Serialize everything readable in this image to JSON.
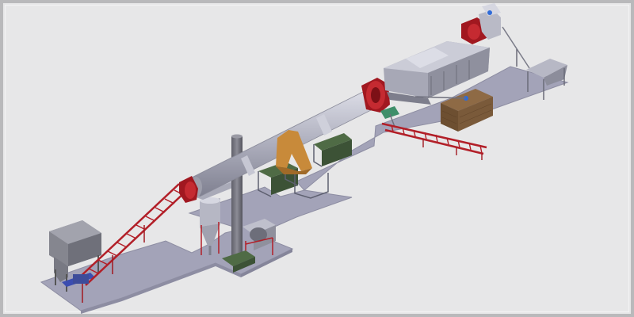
{
  "scene": {
    "background": "#e7e7e8",
    "frame_color": "#b9b9bb",
    "colors": {
      "floor": "#a3a3b8",
      "floor_edge": "#8d8da2",
      "steel_light": "#c9cad6",
      "steel_mid": "#a7a8b7",
      "steel_dark": "#7d7e8e",
      "drum_red": "#a11820",
      "conveyor_red": "#b21f28",
      "bracket_orange": "#c88a3a",
      "brick": "#7a5a3a",
      "camo_green": "#4f6b45",
      "stack_dark": "#6e6e78",
      "baghouse": "#838490"
    }
  }
}
